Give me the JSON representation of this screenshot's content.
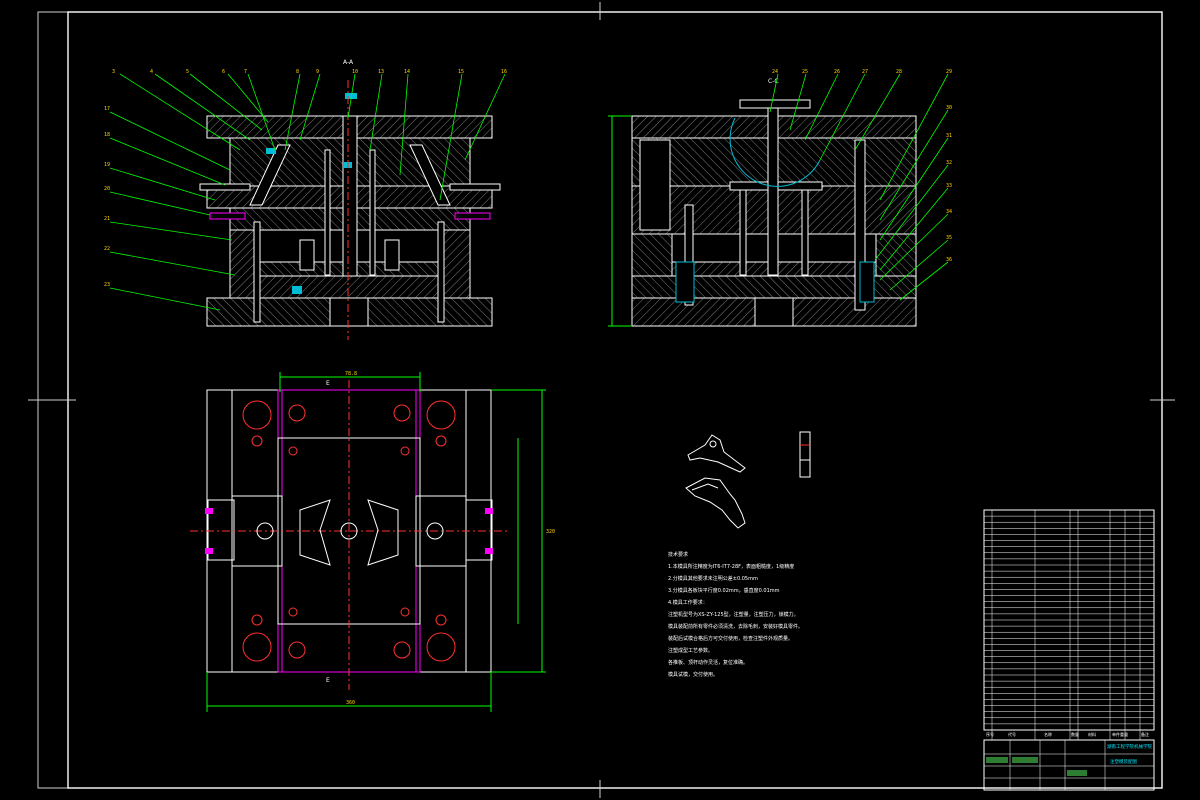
{
  "drawing": {
    "section_label_top": "A-A",
    "section_label_side": "C-C",
    "section_label_plan_top": "E",
    "section_label_plan_bottom": "E",
    "dim_top_label": "78.8",
    "dim_bottom_label": "360",
    "dim_height_label": "320",
    "part_numbers_left": [
      "3",
      "4",
      "5",
      "6",
      "7",
      "8",
      "9",
      "10"
    ],
    "part_numbers_top_left": [
      "13",
      "14",
      "15",
      "16",
      "17",
      "18",
      "19",
      "20",
      "21",
      "22"
    ],
    "part_numbers_top_right": [
      "23",
      "24",
      "25",
      "26",
      "27",
      "28"
    ],
    "part_numbers_right": [
      "29",
      "30",
      "31",
      "32",
      "33",
      "34",
      "35",
      "36"
    ]
  },
  "tech_notes": {
    "lines": [
      "技术要求",
      "1.本模具所注精度为IT6-IT7-28F，表面粗糙度，1级精度",
      "2.分模具其他要求未注明公差±0.05mm",
      "3.分模具各板块平行度0.02mm，垂直度0.01mm",
      "4.模具工作要求：",
      "注塑机型号为XS-ZY-125型，注塑量，注塑压力，锁模力。",
      "模具装配前所有零件必须清洗，去除毛刺，安装好模具零件。",
      "装配后试模合格后方可交付使用，检查注塑件外观质量。",
      "注塑成型工艺参数。",
      "    各推板、顶杆动作灵活，复位准确。",
      "模具试模，交付使用。"
    ]
  },
  "title_block": {
    "school": "湖南工程学院机械学院",
    "drawing_title": "注塑模装配图",
    "headers": [
      "序号",
      "代号",
      "名称",
      "数量",
      "材料",
      "单件重量",
      "备注"
    ],
    "rows": 36
  }
}
